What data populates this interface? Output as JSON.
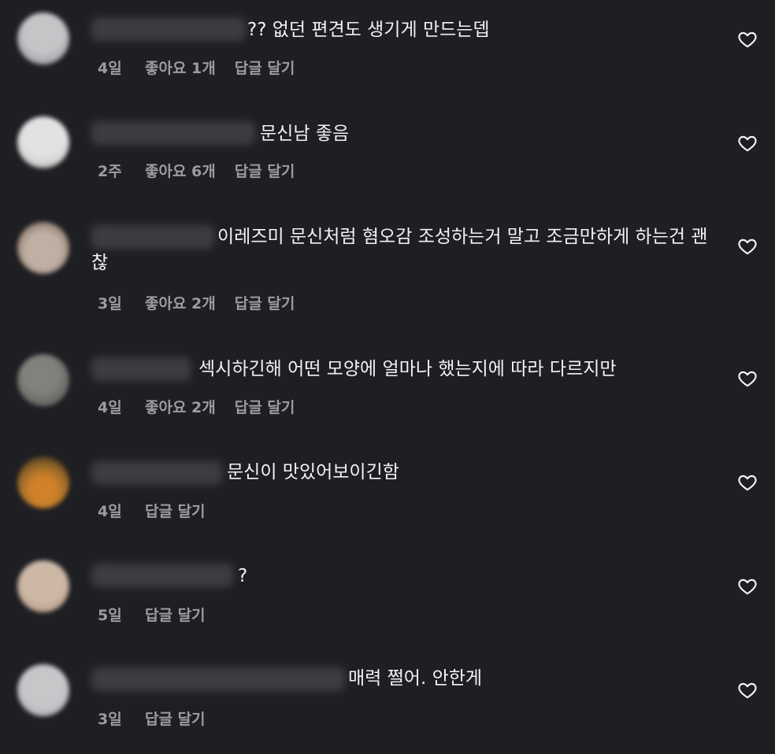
{
  "comments": [
    {
      "text": "?? 없던 편견도 생기게 만드는뎁",
      "time": "4일",
      "likes": "좋아요 1개",
      "reply": "답글 달기"
    },
    {
      "text": "문신남 좋음",
      "time": "2주",
      "likes": "좋아요 6개",
      "reply": "답글 달기"
    },
    {
      "text": "이레즈미 문신처럼 혐오감 조성하는거 말고 조금만하게 하는건 괜찮",
      "time": "3일",
      "likes": "좋아요 2개",
      "reply": "답글 달기"
    },
    {
      "text": "섹시하긴해 어떤 모양에 얼마나 했는지에 따라 다르지만",
      "time": "4일",
      "likes": "좋아요 2개",
      "reply": "답글 달기"
    },
    {
      "text": "문신이 맛있어보이긴함",
      "time": "4일",
      "likes": "",
      "reply": "답글 달기"
    },
    {
      "text": "?",
      "time": "5일",
      "likes": "",
      "reply": "답글 달기"
    },
    {
      "text": "매력 쩔어. 안한게",
      "time": "3일",
      "likes": "",
      "reply": "답글 달기"
    }
  ],
  "icons": {
    "like": "heart-outline-icon"
  },
  "colors": {
    "background": "#1e1f23",
    "text": "#f2f2f2",
    "meta": "#9b9ca1"
  }
}
